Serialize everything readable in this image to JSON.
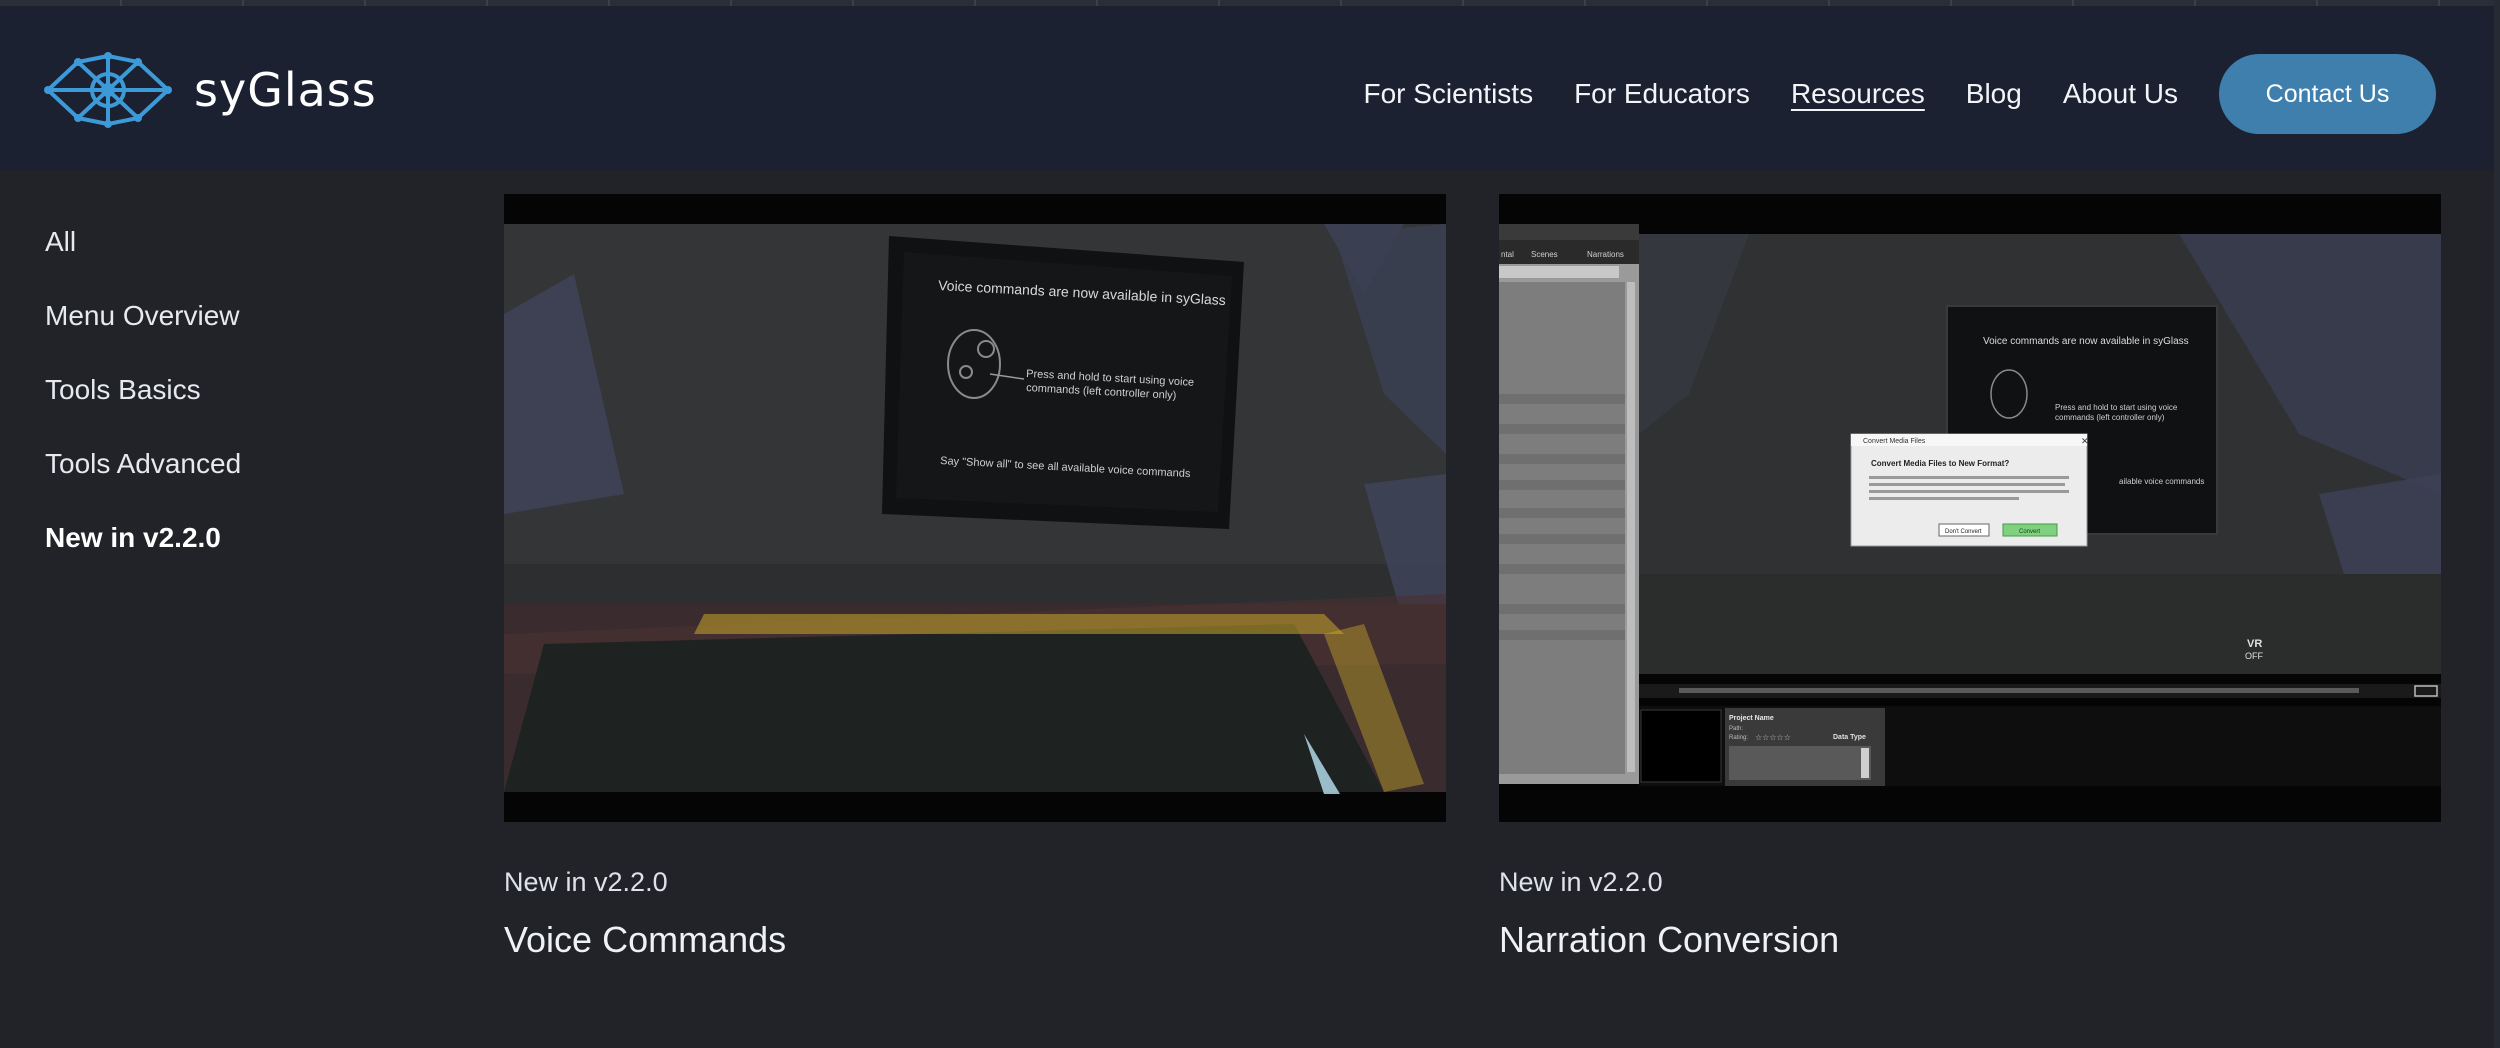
{
  "brand": {
    "name": "syGlass",
    "accent": "#3f7fae",
    "logo_color": "#3d9ad9"
  },
  "nav": {
    "items": [
      {
        "label": "For Scientists"
      },
      {
        "label": "For Educators"
      },
      {
        "label": "Resources",
        "active": true
      },
      {
        "label": "Blog"
      },
      {
        "label": "About Us"
      }
    ],
    "contact_label": "Contact Us"
  },
  "sidebar": {
    "items": [
      {
        "label": "All"
      },
      {
        "label": "Menu Overview"
      },
      {
        "label": "Tools Basics"
      },
      {
        "label": "Tools Advanced"
      },
      {
        "label": "New in v2.2.0",
        "active": true
      }
    ]
  },
  "cards": [
    {
      "tag": "New in v2.2.0",
      "title": "Voice Commands",
      "thumb": {
        "screen_heading": "Voice commands are now available in syGlass",
        "screen_line1": "Press and hold to start using voice",
        "screen_line2": "commands (left controller only)",
        "screen_footer": "Say \"Show all\" to see all available voice commands"
      }
    },
    {
      "tag": "New in v2.2.0",
      "title": "Narration Conversion",
      "thumb": {
        "screen_heading": "Voice commands are now available in syGlass",
        "screen_line1": "Press and hold to start using voice",
        "screen_line2": "commands (left controller only)",
        "screen_footer": "ailable voice commands",
        "dialog_title": "Convert Media Files",
        "dialog_heading": "Convert Media Files to New Format?",
        "dialog_btn_no": "Don't Convert",
        "dialog_btn_yes": "Convert",
        "vr_label": "VR",
        "vr_state": "OFF",
        "project_name": "Project Name",
        "path_label": "Path:",
        "rating_label": "Rating:",
        "data_type_label": "Data Type",
        "tab_1": "ntal",
        "tab_2": "Scenes",
        "tab_3": "Narrations"
      }
    }
  ]
}
